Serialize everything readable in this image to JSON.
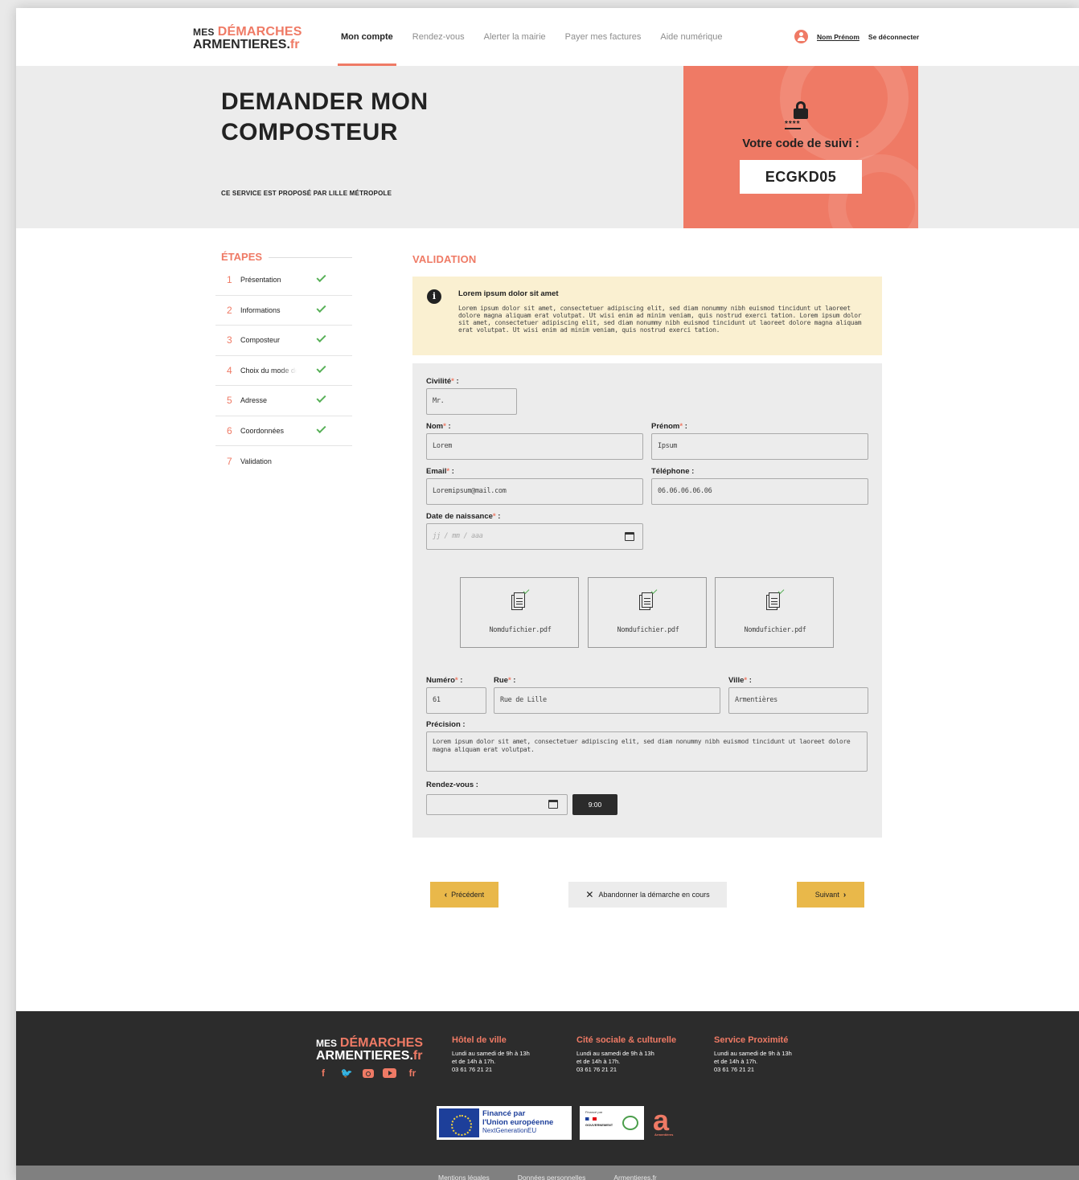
{
  "logo": {
    "line1_prefix": "MES",
    "line1_accent": "DÉMARCHES",
    "line2": "ARMENTIERES.",
    "line2_accent": "fr"
  },
  "nav": [
    {
      "label": "Mon compte",
      "active": true
    },
    {
      "label": "Rendez-vous",
      "active": false
    },
    {
      "label": "Alerter la mairie",
      "active": false
    },
    {
      "label": "Payer mes factures",
      "active": false
    },
    {
      "label": "Aide numérique",
      "active": false
    }
  ],
  "user": {
    "name": "Nom Prénom",
    "logout": "Se déconnecter"
  },
  "hero": {
    "title": "DEMANDER MON COMPOSTEUR",
    "subtitle": "CE SERVICE EST PROPOSÉ PAR LILLE MÉTROPOLE",
    "code_stars": "****",
    "code_label": "Votre code de suivi :",
    "code_value": "ECGKD05"
  },
  "steps": {
    "title": "ÉTAPES",
    "items": [
      {
        "num": "1",
        "label": "Présentation",
        "done": true
      },
      {
        "num": "2",
        "label": "Informations",
        "done": true
      },
      {
        "num": "3",
        "label": "Composteur",
        "done": true
      },
      {
        "num": "4",
        "label": "Choix du mode de r",
        "done": true
      },
      {
        "num": "5",
        "label": "Adresse",
        "done": true
      },
      {
        "num": "6",
        "label": "Coordonnées",
        "done": true
      },
      {
        "num": "7",
        "label": "Validation",
        "done": false
      }
    ]
  },
  "main": {
    "section_title": "VALIDATION",
    "notice": {
      "title": "Lorem ipsum dolor sit amet",
      "text": "Lorem ipsum dolor sit amet, consectetuer adipiscing elit, sed diam nonummy nibh euismod tincidunt ut laoreet dolore magna aliquam erat volutpat. Ut wisi enim ad minim veniam, quis nostrud exerci tation. Lorem ipsum dolor sit amet, consectetuer adipiscing elit, sed diam nonummy nibh euismod tincidunt ut laoreet dolore magna aliquam erat volutpat. Ut wisi enim ad minim veniam, quis nostrud exerci tation."
    },
    "form": {
      "civilite": {
        "label": "Civilité",
        "value": "Mr."
      },
      "nom": {
        "label": "Nom",
        "value": "Lorem"
      },
      "prenom": {
        "label": "Prénom",
        "value": "Ipsum"
      },
      "email": {
        "label": "Email",
        "value": "Loremipsum@mail.com"
      },
      "telephone": {
        "label": "Téléphone :",
        "value": "06.06.06.06.06"
      },
      "naissance": {
        "label": "Date de naissance",
        "placeholder": "jj / mm / aaa"
      },
      "files": [
        "Nomdufichier.pdf",
        "Nomdufichier.pdf",
        "Nomdufichier.pdf"
      ],
      "numero": {
        "label": "Numéro",
        "value": "61"
      },
      "rue": {
        "label": "Rue",
        "value": "Rue de Lille"
      },
      "ville": {
        "label": "Ville",
        "value": "Armentières"
      },
      "precision": {
        "label": "Précision :",
        "value": "Lorem ipsum dolor sit amet, consectetuer adipiscing elit, sed diam nonummy nibh euismod tincidunt ut laoreet dolore magna aliquam erat volutpat."
      },
      "rdv": {
        "label": "Rendez-vous :",
        "time": "9:00"
      },
      "required_mark": "*",
      "colon": " :"
    }
  },
  "actions": {
    "prev": "Précédent",
    "abandon": "Abandonner la démarche en cours",
    "next": "Suivant"
  },
  "footer": {
    "columns": [
      {
        "title": "Hôtel de ville",
        "hours1": "Lundi au samedi de 9h à 13h",
        "hours2": "et de 14h à 17h.",
        "phone": "03 61 76 21 21"
      },
      {
        "title": "Cité sociale & culturelle",
        "hours1": "Lundi au samedi de 9h à 13h",
        "hours2": "et de 14h à 17h.",
        "phone": "03 61 76 21 21"
      },
      {
        "title": "Service Proximité",
        "hours1": "Lundi au samedi de 9h à 13h",
        "hours2": "et de 14h à 17h.",
        "phone": "03 61 76 21 21"
      }
    ],
    "socials": [
      "facebook-icon",
      "twitter-icon",
      "instagram-icon",
      "youtube-icon",
      "fr-icon"
    ],
    "social_fr": "fr",
    "eu": {
      "line1": "Financé par",
      "line2": "l'Union européenne",
      "line3": "NextGenerationEU"
    },
    "gouv": {
      "small": "Financé par",
      "name": "GOUVERNEMENT"
    },
    "a_logo": "a",
    "a_sub": "Armentières",
    "links": [
      "Mentions légales",
      "Données personnelles",
      "Armentieres.fr"
    ]
  },
  "colors": {
    "accent": "#ef7a65",
    "yellow": "#e9b84a",
    "dark": "#2c2c2c",
    "check": "#58b058",
    "notice_bg": "#faf0d1"
  }
}
